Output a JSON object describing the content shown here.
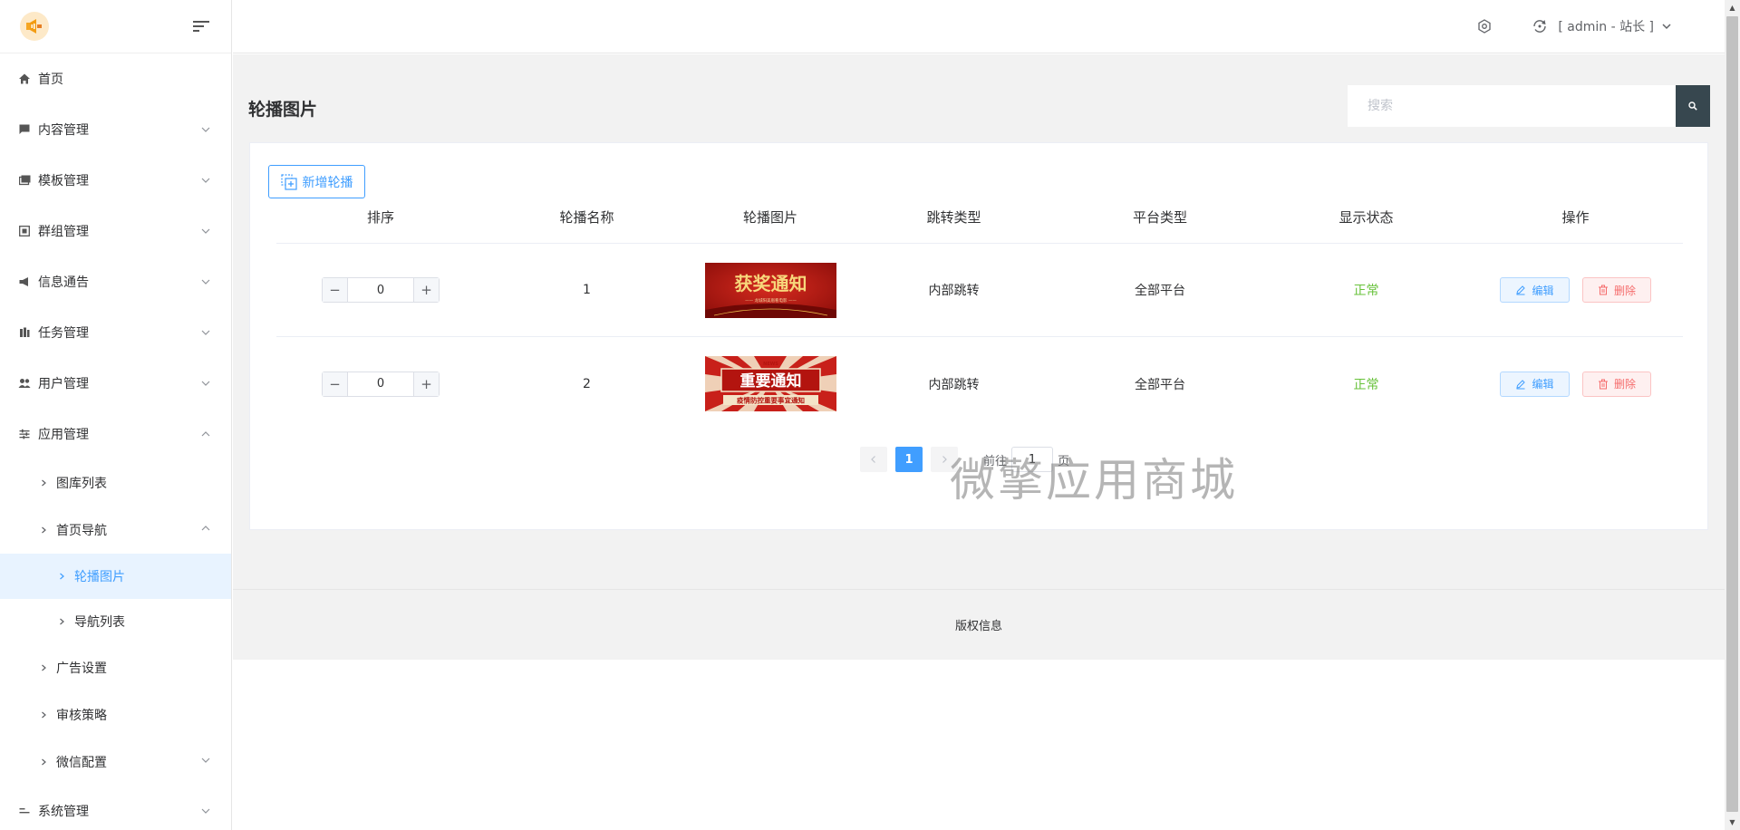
{
  "sidebar": {
    "items": [
      {
        "label": "首页",
        "icon": "home-icon"
      },
      {
        "label": "内容管理",
        "icon": "chat-icon"
      },
      {
        "label": "模板管理",
        "icon": "images-icon"
      },
      {
        "label": "群组管理",
        "icon": "group-icon"
      },
      {
        "label": "信息通告",
        "icon": "megaphone-icon"
      },
      {
        "label": "任务管理",
        "icon": "task-icon"
      },
      {
        "label": "用户管理",
        "icon": "users-icon"
      },
      {
        "label": "应用管理",
        "icon": "sliders-icon"
      }
    ],
    "app_children": [
      {
        "label": "图库列表"
      },
      {
        "label": "首页导航"
      },
      {
        "label": "轮播图片"
      },
      {
        "label": "导航列表"
      },
      {
        "label": "广告设置"
      },
      {
        "label": "审核策略"
      },
      {
        "label": "微信配置"
      }
    ],
    "system": {
      "label": "系统管理",
      "icon": "system-icon"
    }
  },
  "topbar": {
    "user_label": "[ admin - 站长 ]"
  },
  "page": {
    "title": "轮播图片",
    "search_placeholder": "搜索",
    "add_button": "新增轮播"
  },
  "table": {
    "columns": [
      "排序",
      "轮播名称",
      "轮播图片",
      "跳转类型",
      "平台类型",
      "显示状态",
      "操作"
    ],
    "rows": [
      {
        "sort": "0",
        "name": "1",
        "image": "获奖通知",
        "image_sub": "—— 龙城阳美眉看电影 ——",
        "jump": "内部跳转",
        "platform": "全部平台",
        "status": "正常"
      },
      {
        "sort": "0",
        "name": "2",
        "image": "重要通知",
        "image_sub": "疫情防控重要事宜通知",
        "image_tag": "NEWS",
        "jump": "内部跳转",
        "platform": "全部平台",
        "status": "正常"
      }
    ],
    "edit_label": "编辑",
    "delete_label": "删除"
  },
  "pagination": {
    "current": "1",
    "goto_prefix": "前往",
    "goto_value": "1",
    "goto_suffix": "页"
  },
  "watermark": "微擎应用商城",
  "footer": {
    "text": "版权信息"
  },
  "colors": {
    "primary": "#409eff",
    "success": "#67c23a",
    "danger": "#f56c6c",
    "search_button": "#37474f"
  }
}
